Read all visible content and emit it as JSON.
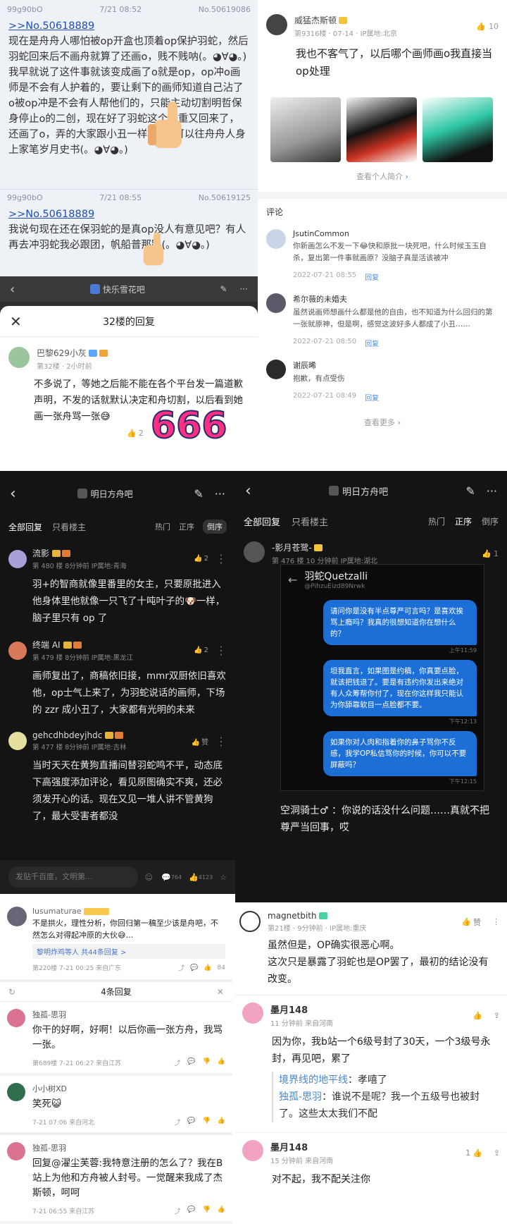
{
  "p1": {
    "post1": {
      "meta_left": "99g90bO",
      "meta_mid": "7/21 08:52",
      "meta_right": "No.50619086",
      "ref": ">>No.50618889",
      "text": "现在是舟舟人哪怕被op开盒也顶着op保护羽蛇，然后羽蛇回来后不画舟就算了还画o，贱不贱呐(。◕∀◕。)\n我早就说了这件事就该变成画了o就是op，op冲o画师是不会有人护着的，要让剩下的画师知道自己沾了o被op冲是不会有人帮他们的，只能主动切割明哲保身停止o的二创，现在好了羽蛇这个减重又回来了，还画了o，弄的大家跟小丑一样，o又可以往舟舟人身上家笔岁月史书(。◕∀◕。)"
    },
    "post2": {
      "meta_left": "99g90bO",
      "meta_mid": "7/21 08:55",
      "meta_right": "No.50619125",
      "ref": ">>No.50618889",
      "text": "我说句现在还在保羽蛇的是真op没人有意见吧？有人再去冲羽蛇我必跟团，帆船普那跟(。◕∀◕。)"
    }
  },
  "p2": {
    "topbar": {
      "title": "快乐雪花吧"
    },
    "sheet": {
      "title": "32楼的回复",
      "user": "巴黎629小灰",
      "floor": "第32楼 · 2小时前",
      "text": "不多说了，等她之后能不能在各个平台发一篇道歉声明，不发的话就默认决定和舟切割，以后看到她画一张舟骂一张😅",
      "likes": "2",
      "sticker": "666"
    }
  },
  "p3": {
    "author": {
      "name": "威猛杰斯顿",
      "sub": "第9316楼 · 07-14 · IP属地:北京",
      "likes": "10",
      "text": "我也不客气了，以后哪个画师画o我直接当op处理"
    },
    "view_profile": "查看个人简介",
    "comments_title": "评论",
    "comments": [
      {
        "name": "JsutinCommon",
        "text": "你新画怎么不发一下😂快和原批一块死吧，什么时候玉玉自杀，复出第一件事就画原？没脑子真是活该被冲",
        "time": "2022-07-21 08:55",
        "reply": "回复"
      },
      {
        "name": "希尔薇的未婚夫",
        "text": "虽然说画师想画什么都是他的自由，也不知道为什么回归的第一张就原神，但是啊，感觉这波好多人都成了小丑……",
        "time": "2022-07-21 08:50",
        "reply": "回复"
      },
      {
        "name": "谢辰晞",
        "text": "抱歉，有点受伤",
        "time": "2022-07-21 08:49",
        "reply": "回复"
      }
    ],
    "more": "查看更多"
  },
  "p4": {
    "forum": "明日方舟吧",
    "tabs": [
      "全部回复",
      "只看楼主"
    ],
    "sorts": [
      "热门",
      "正序",
      "倒序"
    ],
    "posts": [
      {
        "name": "流影",
        "meta": "第 480 楼  8分钟前  IP属地:青海",
        "likes": "2",
        "text": "羽+的智商就像里番里的女主，只要原批进入他身体里他就像一只飞了十吨叶子的🐶一样，脑子里只有 op 了"
      },
      {
        "name": "终端 AI",
        "meta": "第 479 楼  8分钟前  IP属地:黑龙江",
        "likes": "2",
        "text": "画师复出了，商稿依旧接，mmr双厨依旧喜欢他，op士气上来了，为羽蛇说话的画师，下场的 zzr 成小丑了，大家都有光明的未来"
      },
      {
        "name": "gehcdhbdeyjhdc",
        "meta": "第 477 楼  8分钟前  IP属地:吉林",
        "likes": "赞",
        "text": "当时天天在黄狗直播间替羽蛇鸣不平，动态底下高强度添加评论，看见原图确实不爽，还必须发开心的话。现在又见一堆人讲不管黄狗了，最大受害者都没"
      }
    ],
    "input_placeholder": "发贴千百度，文明第...",
    "count1": "764",
    "count2": "4123"
  },
  "p5": {
    "forum": "明日方舟吧",
    "tabs": [
      "全部回复",
      "只看楼主"
    ],
    "sorts": [
      "热门",
      "正序",
      "倒序"
    ],
    "post": {
      "name": "-影月苍鹭-",
      "meta": "第 476 楼  10 分钟前  IP属地:湖北",
      "likes": "1"
    },
    "chat": {
      "title": "羽蛇Quetzalli",
      "handle": "@PihzuEizd89Nrwk",
      "msgs": [
        {
          "text": "请问你是没有半点尊严可言吗？是喜欢挨骂上瘾吗？我真的很想知道你在想什么的？",
          "time": "上午11:59"
        },
        {
          "text": "坦我直言，如果图是约稿，你真要点脸，就该把钱退了。要是有违约你发出来绝对有人众筹帮你付了，现在你这样我只能认为你舔靠软目一点脸都不要。",
          "time": "下午12:13"
        },
        {
          "text": "如果你对人肉和指着你的鼻子骂你不反感，我学OP私信骂你的时候，你可以不要屏蔽吗？",
          "time": "下午12:15"
        }
      ]
    },
    "caption": "空洞骑士♂ ：你说的话没什么问题……真就不把尊严当回事，哎"
  },
  "p6": {
    "top": {
      "name": "lusumaturae",
      "text": "不是拱火，理性分析，你回归第一稿至少该是舟吧，不然怎么对得起冲原的大伙😅…",
      "replies": "黎明炸鸡等人 共44条回复 >",
      "meta": "第220楼 7-21 00:25 来自广东",
      "likes": "84"
    },
    "sheet_title": "4条回复",
    "replies": [
      {
        "name": "独孤-思羽",
        "text": "你干的好啊，好啊！以后你画一张方舟，我骂一张。",
        "meta": "第689楼 7-21 06:27 来自江苏"
      },
      {
        "name": "小小树XD",
        "text": "笑死😺",
        "meta": "7-21 07:06 来自河北"
      },
      {
        "name": "独孤-思羽",
        "text": "回复@濯尘芙蓉:我特意注册的怎么了？我在B站上为他和方舟被人封号。一觉醒来我成了杰斯顿，呵呵",
        "meta": "7-21 06:55 来自江苏"
      }
    ]
  },
  "p7": {
    "top": {
      "name": "magnetbith",
      "meta": "第21楼 · 9分钟前 · IP属地:重庆",
      "likes": "赞",
      "text": "虽然但是，OP确实很恶心啊。\n这次只是暴露了羽蛇也是OP罢了，最初的结论没有改变。"
    },
    "c1": {
      "name": "墨月148",
      "meta": "11 分钟前  来自河南",
      "text": "因为你，我b站一个6级号封了30天，一个3级号永封，再见吧，累了",
      "subs": [
        {
          "name": "境界线的地平线",
          "text": "：孝嘻了"
        },
        {
          "name": "独孤-思羽",
          "text": "：谁说不是呢？我一个五级号也被封了。这些太太我们不配"
        }
      ]
    },
    "c2": {
      "name": "墨月148",
      "meta": "15 分钟前  来自河南",
      "likes": "1",
      "text": "对不起，我不配关注你"
    }
  }
}
